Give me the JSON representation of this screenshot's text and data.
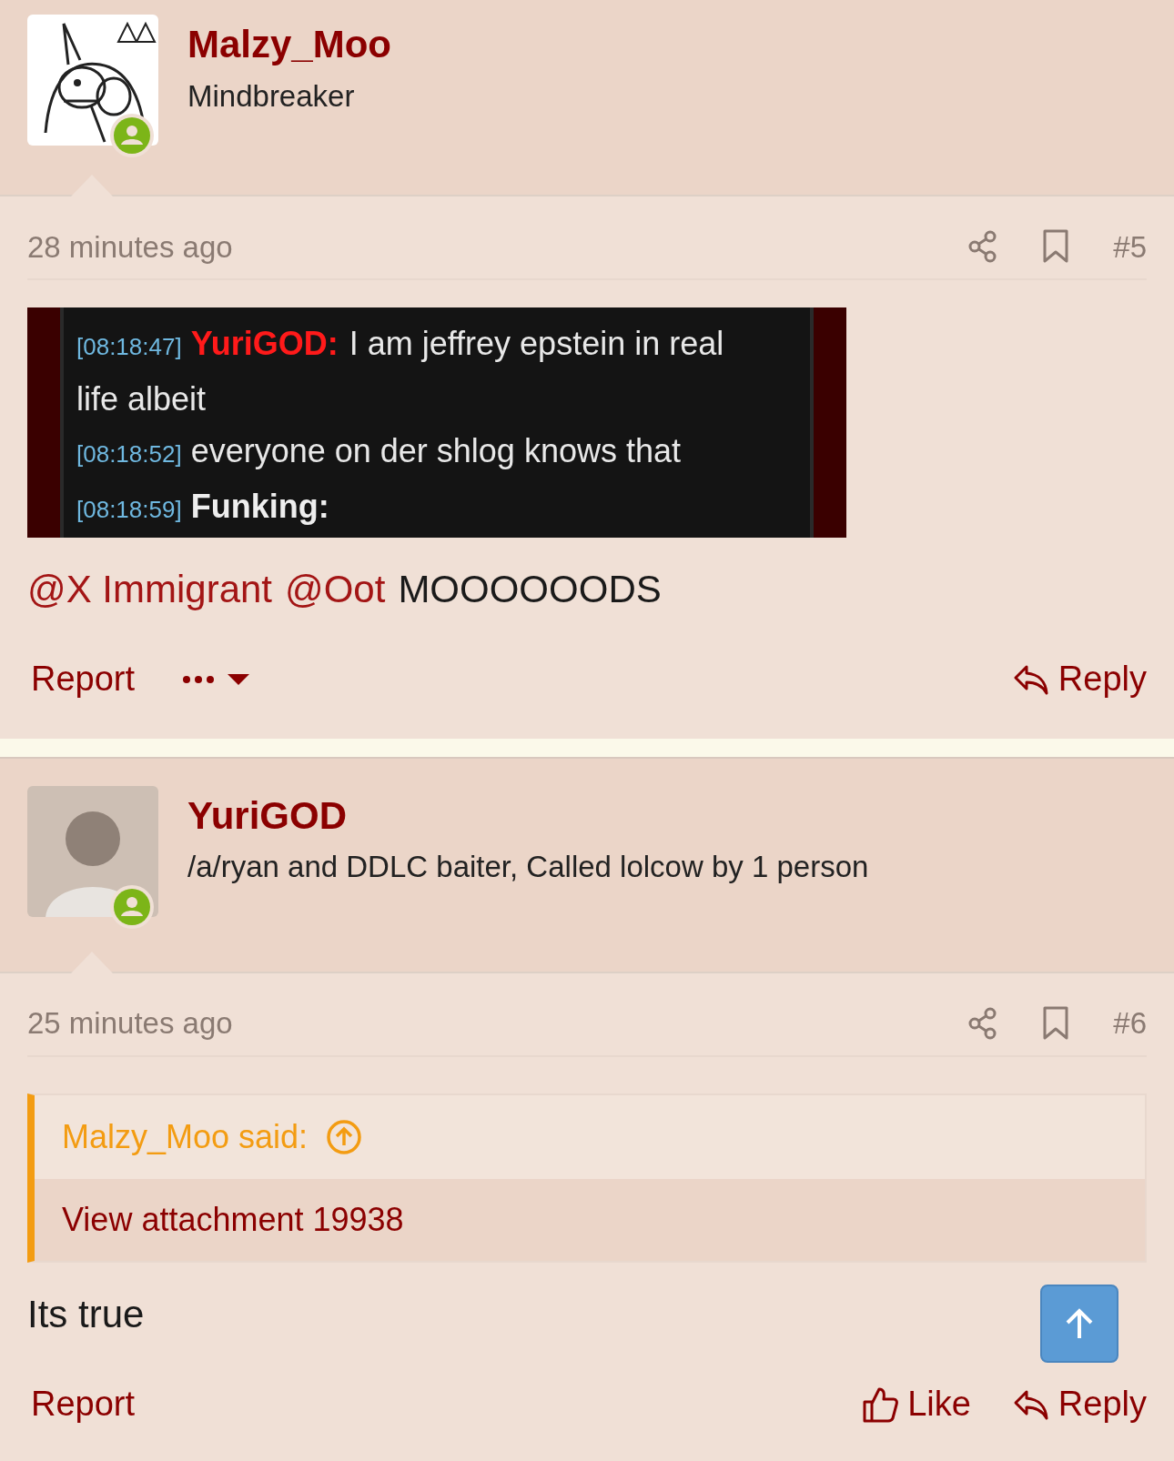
{
  "posts": [
    {
      "author": "Malzy_Moo",
      "user_title": "Mindbreaker",
      "online": true,
      "avatar": {
        "kind": "picture"
      },
      "time": "28 minutes ago",
      "number": "#5",
      "attachment": {
        "lines": [
          {
            "kind": "highlight",
            "timestamp": "[08:18:47]",
            "speaker": "YuriGOD:",
            "text": "I am jeffrey epstein in real"
          },
          {
            "text": "life albeit"
          },
          {
            "timestamp": "[08:18:52]",
            "text": "everyone on der shlog knows that"
          },
          {
            "kind": "plain",
            "timestamp": "[08:18:59]",
            "speaker": "Funking:"
          }
        ]
      },
      "body": [
        {
          "kind": "mention",
          "text": "@X Immigrant"
        },
        {
          "kind": "mention",
          "text": "@Oot"
        },
        {
          "kind": "text",
          "text": "MOOOOOODS"
        }
      ],
      "report": "Report",
      "reply": "Reply"
    },
    {
      "author": "YuriGOD",
      "user_title": "/a/ryan and DDLC baiter, Called lolcow by 1 person",
      "online": true,
      "avatar": {
        "kind": "silhouette"
      },
      "time": "25 minutes ago",
      "number": "#6",
      "quote": {
        "author": "Malzy_Moo said:",
        "link": "View attachment 19938"
      },
      "body": [
        {
          "kind": "text",
          "text": "Its true"
        }
      ],
      "report": "Report",
      "like": "Like",
      "reply": "Reply"
    }
  ]
}
